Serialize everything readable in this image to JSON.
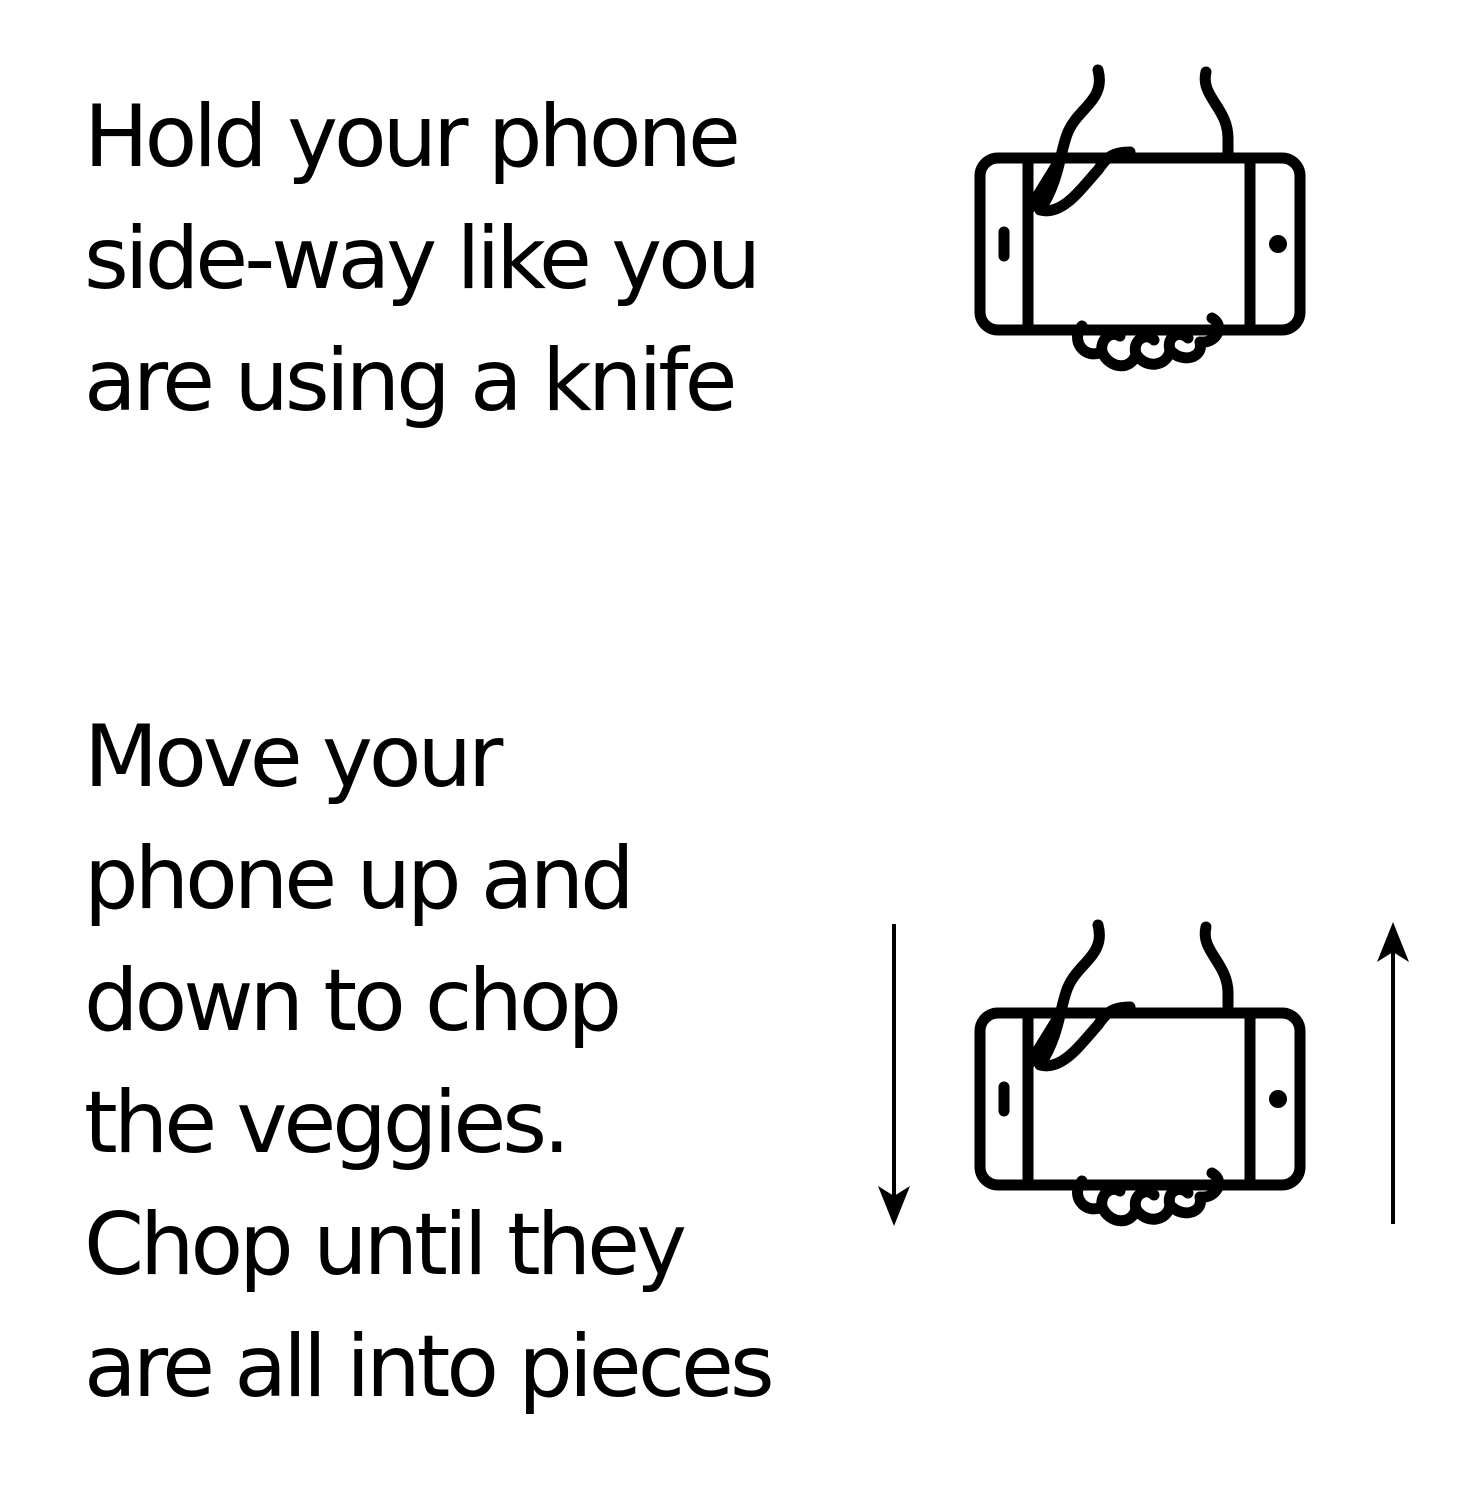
{
  "steps": [
    {
      "lines": [
        "Hold your phone",
        "side-way like you",
        "are using a knife"
      ],
      "icon": "hand-holding-phone-sideways-icon"
    },
    {
      "lines": [
        "Move your",
        "phone up and",
        "down to chop",
        "the veggies.",
        "Chop until they",
        "are all into pieces"
      ],
      "icon": "hand-holding-phone-sideways-icon",
      "motion_arrows": [
        "arrow-down-icon",
        "arrow-up-icon"
      ]
    }
  ],
  "colors": {
    "background": "#ffffff",
    "ink": "#000000"
  }
}
